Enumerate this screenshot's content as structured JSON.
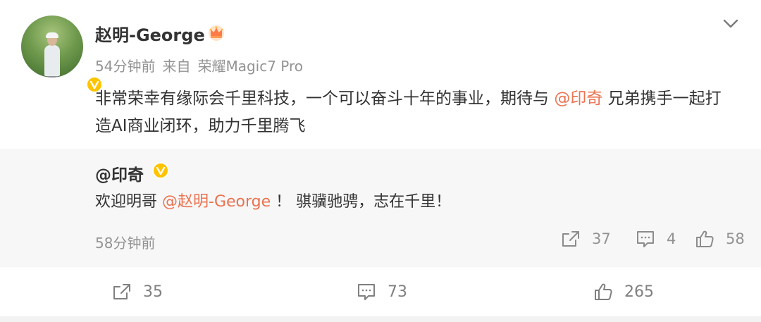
{
  "post": {
    "author": "赵明-George",
    "meta": {
      "time": "54分钟前",
      "source_prefix": "来自",
      "device": "荣耀Magic7 Pro"
    },
    "content": {
      "part1": "非常荣幸有缘际会千里科技，一个可以奋斗十年的事业，期待与",
      "mention": "@印奇",
      "part2": "兄弟携手一起打造AI商业闭环，助力千里腾飞"
    },
    "icons": {
      "crown": "crown-icon",
      "verified": "verified-badge-icon",
      "more": "chevron-down-icon"
    }
  },
  "repost": {
    "author": "@印奇",
    "text": {
      "part1": "欢迎明哥",
      "mention": "@赵明-George",
      "part2": "！ 骐骥驰骋，志在千里！"
    },
    "time": "58分钟前",
    "actions": {
      "forward": "37",
      "comment": "4",
      "like": "58"
    }
  },
  "footer": {
    "forward": "35",
    "comment": "73",
    "like": "265"
  },
  "colors": {
    "mention": "#eb7350",
    "muted": "#939393",
    "repost_bg": "#f7f7f7",
    "verified": "#ffc400"
  }
}
